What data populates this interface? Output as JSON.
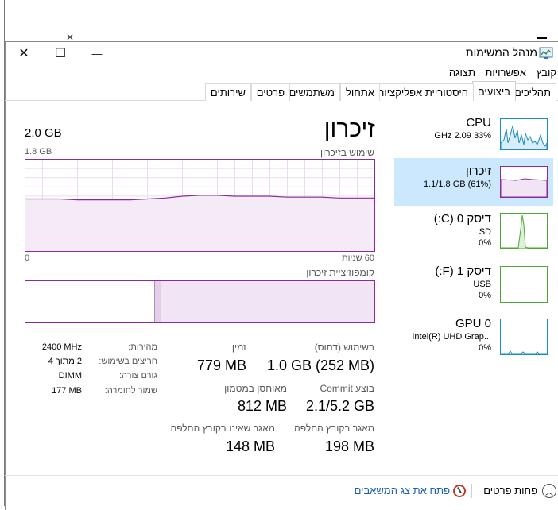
{
  "window": {
    "title": "מנהל המשימות"
  },
  "caption": {
    "close": "✕",
    "maximize": "☐",
    "minimize": "—"
  },
  "menu": [
    "קובץ",
    "אפשרויות",
    "תצוגה"
  ],
  "tabs": [
    "תהליכים",
    "ביצועים",
    "היסטוריית אפליקציות",
    "אתחול",
    "משתמשים",
    "פרטים",
    "שירותים"
  ],
  "active_tab": "ביצועים",
  "sidebar": [
    {
      "title": "CPU",
      "sub1": "33% 2.09 GHz",
      "sub2": "",
      "color": "#1b8cbf",
      "icon": "cpu-graph"
    },
    {
      "title": "זיכרון",
      "sub1": "1.1/1.8 GB (61%)",
      "sub2": "",
      "color": "#8b2a9e",
      "icon": "memory-graph"
    },
    {
      "title": "דיסק 0 (C:)",
      "sub1": "SD",
      "sub2": "0%",
      "color": "#4ca832",
      "icon": "disk-graph"
    },
    {
      "title": "דיסק 1 (F:)",
      "sub1": "USB",
      "sub2": "0%",
      "color": "#4ca832",
      "icon": "disk-graph"
    },
    {
      "title": "GPU 0",
      "sub1": "Intel(R) UHD Grap...",
      "sub2": "0%",
      "color": "#1b8cbf",
      "icon": "gpu-graph"
    }
  ],
  "main": {
    "title": "זיכרון",
    "total": "2.0 GB",
    "usage_label": "שימוש בזיכרון",
    "usage_max": "1.8 GB",
    "x_left": "60 שניות",
    "x_right": "0",
    "composition_label": "קומפוזיציית זיכרון",
    "memory_usage_series": [
      57,
      57,
      57,
      56,
      56,
      56,
      56,
      57,
      58,
      60,
      61,
      61,
      60,
      60,
      60,
      59,
      59,
      59,
      58,
      58,
      58
    ],
    "composition": {
      "in_use": 61,
      "modified": 2
    },
    "stats": {
      "in_use_label": "בשימוש (דחוס)",
      "in_use_value": "1.0 GB (252 MB)",
      "available_label": "זמין",
      "available_value": "779 MB",
      "committed_label": "בוצע Commit",
      "committed_value": "2.1/5.2 GB",
      "cached_label": "מאוחסן במטמון",
      "cached_value": "812 MB",
      "paged_label": "מאגר בקובץ החלפה",
      "paged_value": "198 MB",
      "nonpaged_label": "מאגר שאינו בקובץ החלפה",
      "nonpaged_value": "148 MB"
    },
    "details": [
      {
        "label": "מהירות:",
        "value": "2400 MHz"
      },
      {
        "label": "חריצים בשימוש:",
        "value": "2 מתוך 4"
      },
      {
        "label": "גורם צורה:",
        "value": "DIMM"
      },
      {
        "label": "שמור לחומרה:",
        "value": "177 MB"
      }
    ]
  },
  "footer": {
    "fewer_details": "פחות פרטים",
    "open_monitor": "פתח את צג המשאבים"
  }
}
